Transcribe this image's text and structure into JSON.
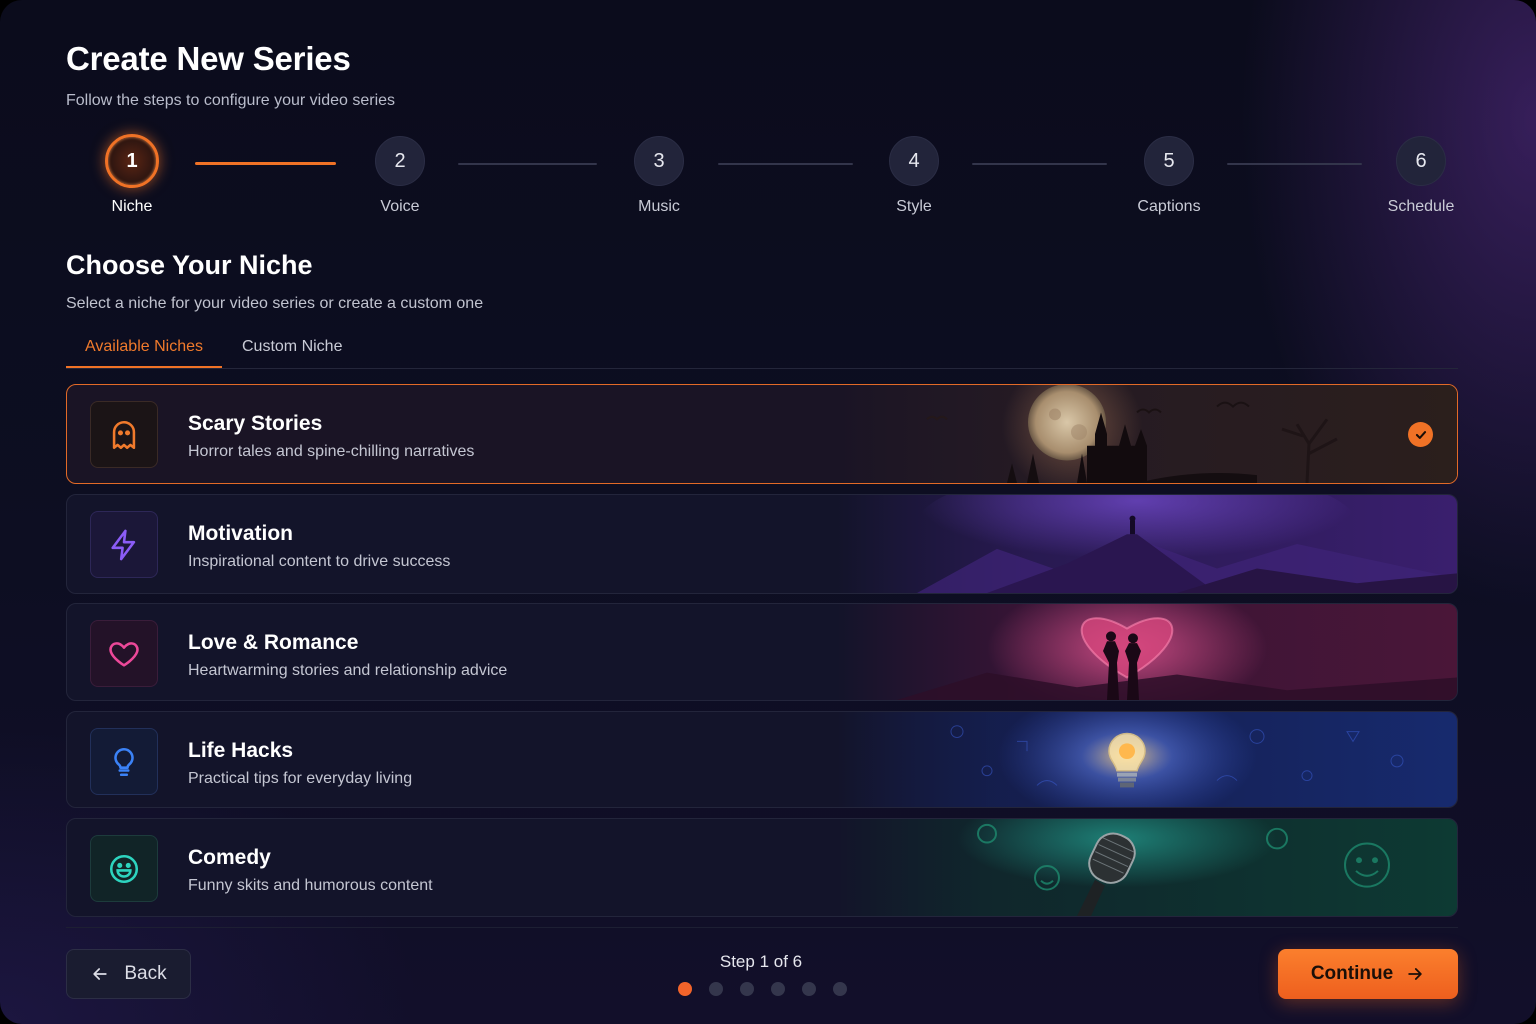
{
  "header": {
    "title": "Create New Series",
    "subtitle": "Follow the steps to configure your video series"
  },
  "stepper": {
    "steps": [
      {
        "number": "1",
        "label": "Niche",
        "state": "active"
      },
      {
        "number": "2",
        "label": "Voice",
        "state": "upcoming"
      },
      {
        "number": "3",
        "label": "Music",
        "state": "upcoming"
      },
      {
        "number": "4",
        "label": "Style",
        "state": "upcoming"
      },
      {
        "number": "5",
        "label": "Captions",
        "state": "upcoming"
      },
      {
        "number": "6",
        "label": "Schedule",
        "state": "upcoming"
      }
    ]
  },
  "section": {
    "title": "Choose Your Niche",
    "subtitle": "Select a niche for your video series or create a custom one"
  },
  "tabs": [
    {
      "label": "Available Niches",
      "active": true
    },
    {
      "label": "Custom Niche",
      "active": false
    }
  ],
  "niches": [
    {
      "title": "Scary Stories",
      "description": "Horror tales and spine-chilling narratives",
      "icon": "ghost-icon",
      "accent": "#f07a2c",
      "selected": true
    },
    {
      "title": "Motivation",
      "description": "Inspirational content to drive success",
      "icon": "lightning-icon",
      "accent": "#8b5cf6",
      "selected": false
    },
    {
      "title": "Love & Romance",
      "description": "Heartwarming stories and relationship advice",
      "icon": "heart-icon",
      "accent": "#ec4899",
      "selected": false
    },
    {
      "title": "Life Hacks",
      "description": "Practical tips for everyday living",
      "icon": "lightbulb-icon",
      "accent": "#3b82f6",
      "selected": false
    },
    {
      "title": "Comedy",
      "description": "Funny skits and humorous content",
      "icon": "smiley-icon",
      "accent": "#2dd4bf",
      "selected": false
    }
  ],
  "footer": {
    "back_label": "Back",
    "step_indicator": "Step 1 of 6",
    "continue_label": "Continue",
    "current_step": 1,
    "total_steps": 6
  },
  "colors": {
    "accent": "#f07226",
    "background": "#0b0c1c"
  }
}
